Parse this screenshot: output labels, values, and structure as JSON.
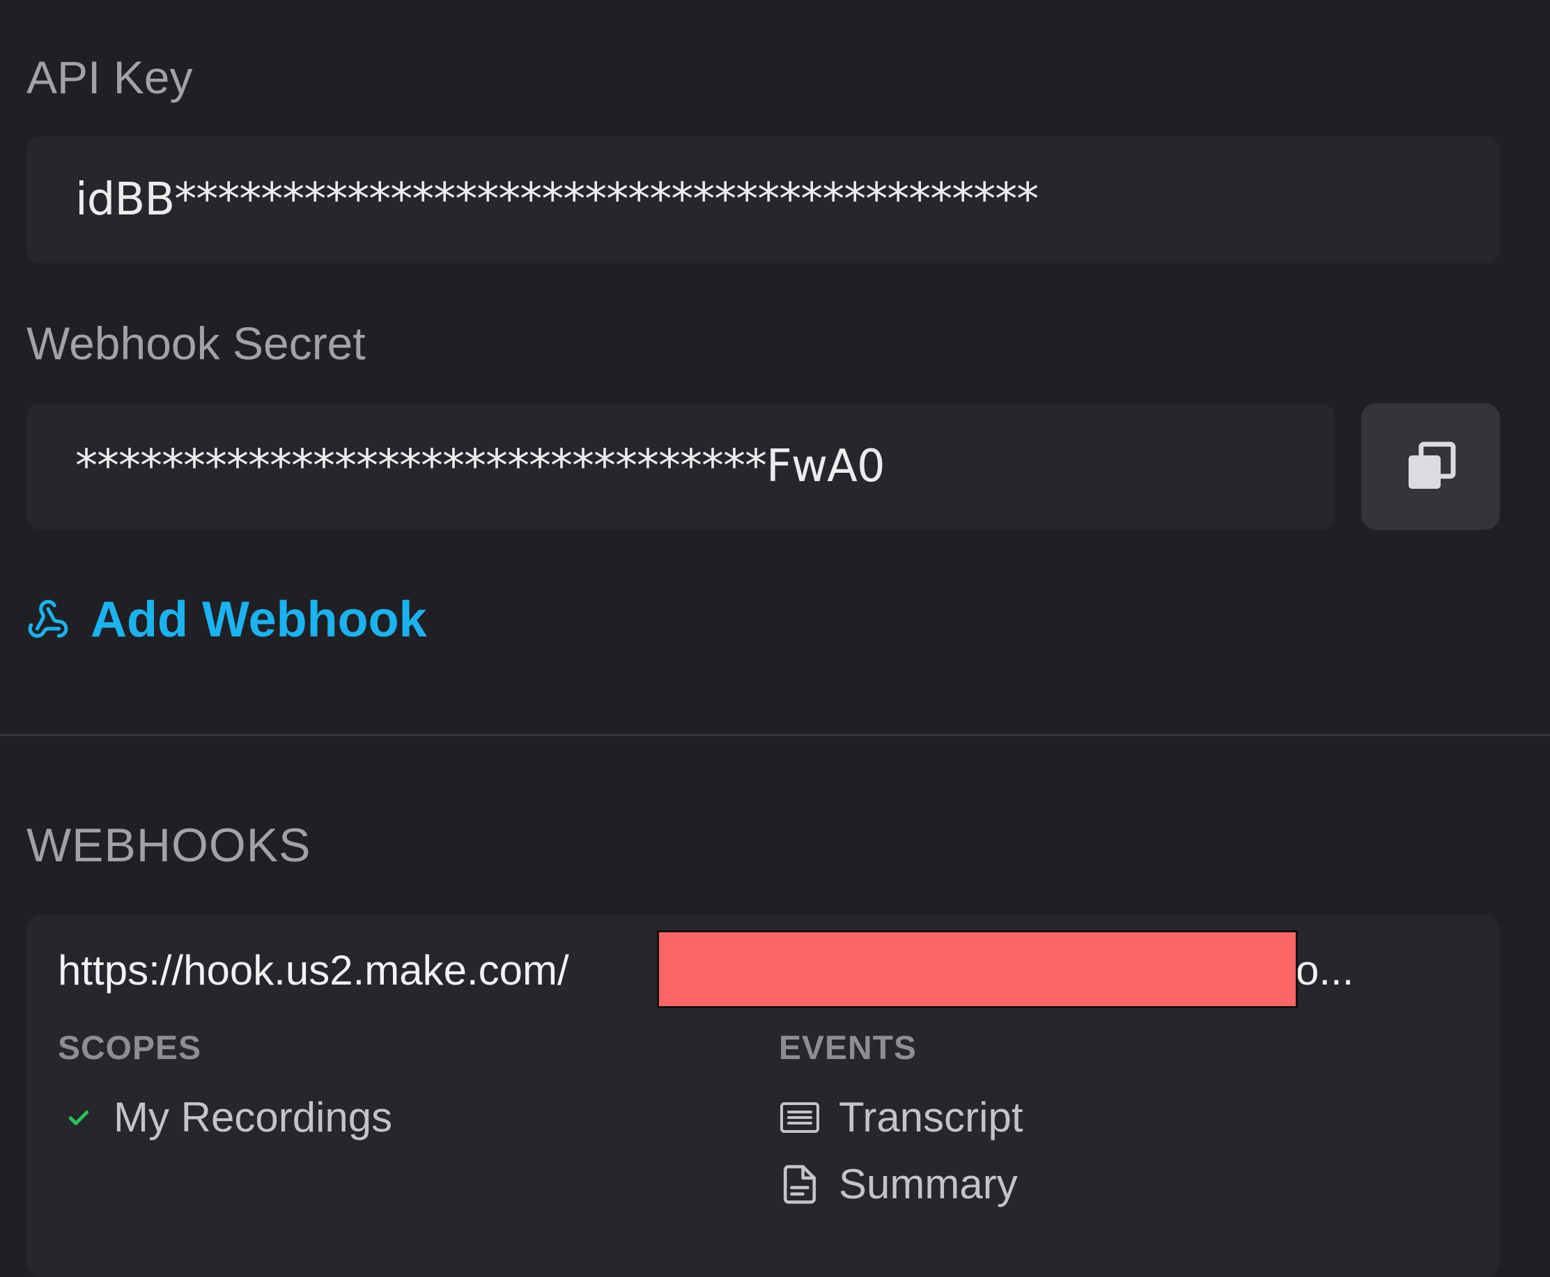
{
  "api_key": {
    "label": "API Key",
    "value": "idBB****************************************"
  },
  "webhook_secret": {
    "label": "Webhook Secret",
    "value": "********************************FwA0",
    "copy_icon": "copy-icon"
  },
  "add_webhook": {
    "label": "Add Webhook",
    "icon": "webhook-icon",
    "color": "#1ab3f0"
  },
  "webhooks": {
    "section_title": "WEBHOOKS",
    "items": [
      {
        "url_start": "https://hook.us2.make.com/",
        "url_tail": "o...",
        "scopes_header": "SCOPES",
        "scopes": [
          {
            "label": "My Recordings",
            "icon": "check-icon"
          }
        ],
        "events_header": "EVENTS",
        "events": [
          {
            "label": "Transcript",
            "icon": "transcript-icon"
          },
          {
            "label": "Summary",
            "icon": "summary-document-icon"
          }
        ]
      }
    ]
  },
  "colors": {
    "background": "#202024",
    "field_background": "#27272b",
    "accent": "#1ab3f0",
    "check": "#22c55e",
    "redaction": "#fe6565"
  }
}
